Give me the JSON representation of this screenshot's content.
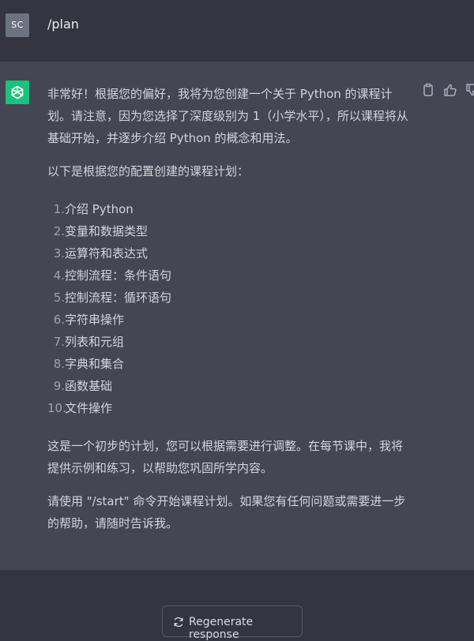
{
  "user_message": {
    "avatar_initials": "SC",
    "text": "/plan"
  },
  "assistant_message": {
    "avatar_icon": "openai-logo-icon",
    "actions": [
      "copy-icon",
      "thumbs-up-icon",
      "thumbs-down-icon"
    ],
    "paragraphs": [
      "非常好！根据您的偏好，我将为您创建一个关于 Python 的课程计划。请注意，因为您选择了深度级别为 1（小学水平），所以课程将从基础开始，并逐步介绍 Python 的概念和用法。",
      "以下是根据您的配置创建的课程计划："
    ],
    "plan_items": [
      {
        "num": "1.",
        "text": "介绍 Python"
      },
      {
        "num": "2.",
        "text": "变量和数据类型"
      },
      {
        "num": "3.",
        "text": "运算符和表达式"
      },
      {
        "num": "4.",
        "text": "控制流程：条件语句"
      },
      {
        "num": "5.",
        "text": "控制流程：循环语句"
      },
      {
        "num": "6.",
        "text": "字符串操作"
      },
      {
        "num": "7.",
        "text": "列表和元组"
      },
      {
        "num": "8.",
        "text": "字典和集合"
      },
      {
        "num": "9.",
        "text": "函数基础"
      },
      {
        "num": "10.",
        "text": "文件操作"
      }
    ],
    "closing_paragraphs": [
      "这是一个初步的计划，您可以根据需要进行调整。在每节课中，我将提供示例和练习，以帮助您巩固所学内容。",
      "请使用 \"/start\" 命令开始课程计划。如果您有任何问题或需要进一步的帮助，请随时告诉我。"
    ]
  },
  "regenerate_button": {
    "label": "Regenerate response",
    "icon": "refresh-icon"
  },
  "colors": {
    "user_background": "#343541",
    "assistant_background": "#444654",
    "avatar_gpt": "#19c37d",
    "avatar_user": "#6b7280"
  }
}
